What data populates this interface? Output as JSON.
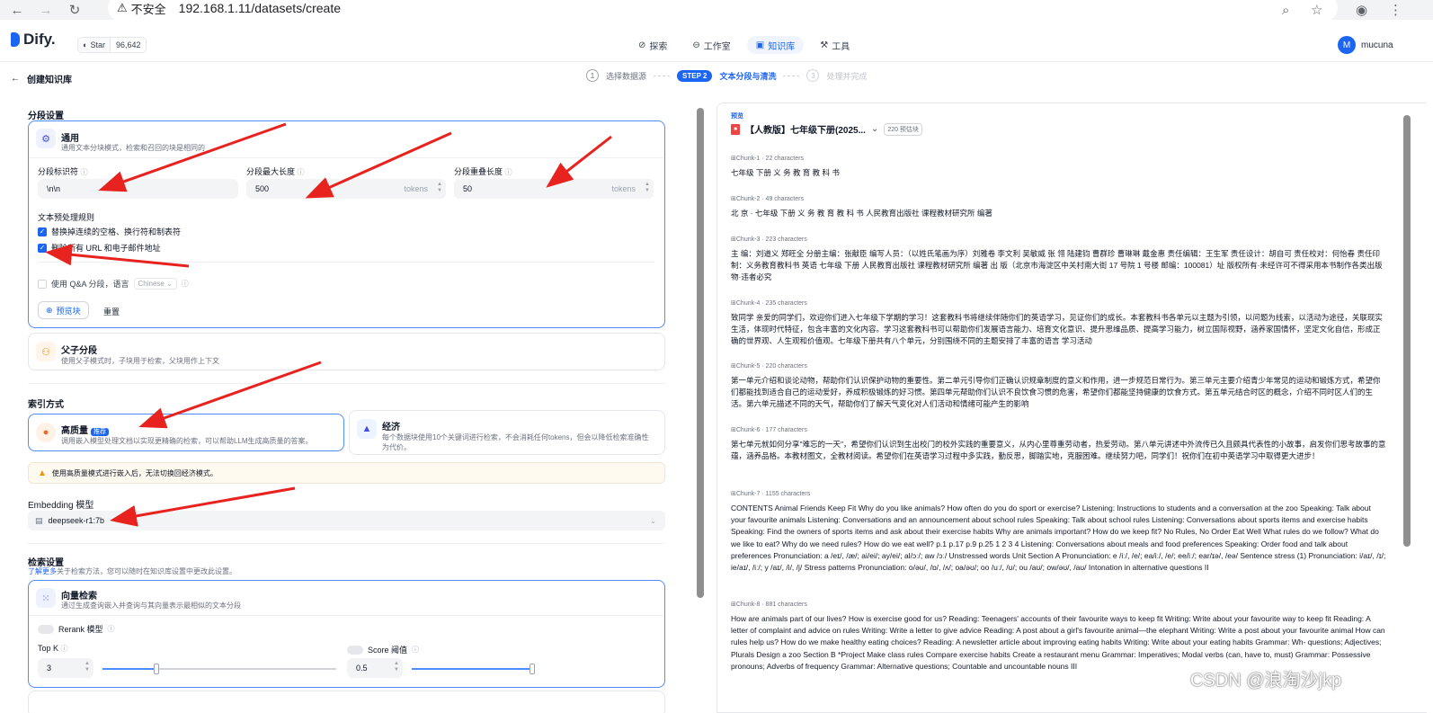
{
  "browser": {
    "security_label": "不安全",
    "url": "192.168.1.11/datasets/create"
  },
  "header": {
    "logo_text": "Dify.",
    "star_label": "Star",
    "star_count": "96,642",
    "nav": [
      {
        "label": "探索",
        "icon": "compass-icon",
        "active": false
      },
      {
        "label": "工作室",
        "icon": "terminal-icon",
        "active": false
      },
      {
        "label": "知识库",
        "icon": "book-icon",
        "active": true
      },
      {
        "label": "工具",
        "icon": "tool-icon",
        "active": false
      }
    ],
    "user_initial": "M",
    "user_name": "mucuna"
  },
  "page": {
    "back_label": "创建知识库",
    "steps": [
      {
        "num": "1",
        "label": "选择数据源"
      },
      {
        "num": "STEP 2",
        "label": "文本分段与清洗"
      },
      {
        "num": "3",
        "label": "处理并完成"
      }
    ]
  },
  "segment": {
    "title": "分段设置",
    "general": {
      "title": "通用",
      "desc": "通用文本分块模式，检索和召回的块是相同的",
      "separator_label": "分段标识符",
      "separator_value": "\\n\\n",
      "max_len_label": "分段最大长度",
      "max_len_value": "500",
      "overlap_label": "分段重叠长度",
      "overlap_value": "50",
      "unit": "tokens",
      "rules_label": "文本预处理规则",
      "rule1": "替换掉连续的空格、换行符和制表符",
      "rule2": "删除所有 URL 和电子邮件地址",
      "qa_label": "使用 Q&A 分段，语言",
      "qa_lang": "Chinese",
      "preview_btn": "预览块",
      "reset_btn": "重置"
    },
    "parent_child": {
      "title": "父子分段",
      "desc": "使用父子模式时，子块用于检索，父块用作上下文"
    }
  },
  "index": {
    "title": "索引方式",
    "high": {
      "title": "高质量",
      "badge": "推荐",
      "desc": "调用嵌入模型处理文档以实现更精确的检索，可以帮助LLM生成高质量的答案。"
    },
    "economy": {
      "title": "经济",
      "desc1": "每个数据块使用10个关键词进行检索，不会消耗任何tokens，但会以降低检索准确性",
      "desc2": "为代价。"
    },
    "warning": "使用高质量模式进行嵌入后，无法切换回经济模式。",
    "embedding_label": "Embedding 模型",
    "embedding_value": "deepseek-r1:7b"
  },
  "retrieval": {
    "title": "检索设置",
    "more_link": "了解更多",
    "desc": "关于检索方法，您可以随时在知识库设置中更改此设置。",
    "vector": {
      "title": "向量检索",
      "desc": "通过生成查询嵌入并查询与其向量表示最相似的文本分段"
    },
    "rerank_label": "Rerank 模型",
    "topk_label": "Top K",
    "topk_value": "3",
    "score_label": "Score 阈值",
    "score_value": "0.5"
  },
  "preview": {
    "heading": "预览",
    "doc_title": "【人教版】七年级下册(2025...",
    "doc_badge": "220 预估块",
    "chunks": [
      {
        "meta": "Chunk-1 · 22 characters",
        "text": "七年级 下册 义 务 教 育 教 科 书"
      },
      {
        "meta": "Chunk-2 · 49 characters",
        "text": "北 京 · 七年级 下册 义 务 教 育 教 科 书 人民教育出版社 课程教材研究所 编著"
      },
      {
        "meta": "Chunk-3 · 223 characters",
        "text": "主 编：刘道义 郑旺全 分册主编：张献臣 编写人员：（以姓氏笔画为序）刘雅卷 李文利 吴敏威 张 翎 陆建钧 曹群珍 曹琳琳 戴金惠 责任编辑：王生军 责任设计：胡自可 责任校对：何怡春 责任印制：义务教育教科书 英语 七年级 下册 人民教育出版社 课程教材研究所 编著 出 版（北京市海淀区中关村南大街 17 号院 1 号楼 邮编：100081）址 版权所有·未经许可不得采用本书制作各类出版物·违者必究"
      },
      {
        "meta": "Chunk-4 · 235 characters",
        "text": "致同学 亲爱的同学们，欢迎你们进入七年级下学期的学习！这套教科书将继续伴随你们的英语学习，见证你们的成长。本套教科书各单元以主题为引领，以问题为线索，以活动为途径，关联现实生活，体现时代特征，包含丰富的文化内容。学习这套教科书可以帮助你们发展语言能力、培育文化意识、提升思维品质、提高学习能力，树立国际视野，涵养家国情怀，坚定文化自信，形成正确的世界观、人生观和价值观。七年级下册共有八个单元，分别围绕不同的主题安排了丰富的语言 学习活动"
      },
      {
        "meta": "Chunk-5 · 220 characters",
        "text": "第一单元介绍和谈论动物，帮助你们认识保护动物的重要性。第二单元引导你们正确认识规章制度的意义和作用，进一步规范日常行为。第三单元主要介绍青少年常见的运动和锻炼方式，希望你们都能找到适合自己的运动爱好，养成积极锻炼的好习惯。第四单元帮助你们认识不良饮食习惯的危害，希望你们都能坚持健康的饮食方式。第五单元结合时区的概念，介绍不同时区人们的生活。第六单元描述不同的天气，帮助你们了解天气变化对人们活动和情绪可能产生的影响"
      },
      {
        "meta": "Chunk-6 · 177 characters",
        "text": "第七单元就如何分享\"难忘的一天\"，希望你们认识到生出校门的校外实践的重要意义，从内心里尊重劳动者，热爱劳动。第八单元讲述中外流传已久且颇具代表性的小故事，启发你们思考故事的意蕴，涵养品格。本教材图文，全教材阅读。希望你们在英语学习过程中多实践，勤反思，脚踏实地，克服困难。继续努力吧，同学们！祝你们在初中英语学习中取得更大进步！"
      },
      {
        "meta": "Chunk-7 · 1155 characters",
        "text": "CONTENTS Animal Friends Keep Fit Why do you like animals? How often do you do sport or exercise? Listening: Instructions to students and a conversation at the zoo Speaking: Talk about your favourite animals Listening: Conversations and an announcement about school rules Speaking: Talk about school rules Listening: Conversations about sports items and exercise habits Speaking: Find the owners of sports items and ask about their exercise habits Why are animals important? How do we keep fit? No Rules, No Order Eat Well What rules do we follow? What do we like to eat? Why do we need rules? How do we eat well? p.1 p.17 p.9 p.25 1 2 3 4 Listening: Conversations about meals and food preferences Speaking: Order food and talk about preferences Pronunciation: a /eɪ/, /æ/; ai/ei/; ay/ei/; al/ɔː/; aw /ɔː/ Unstressed words Unit Section A Pronunciation: e /iː/, /e/; ea/iː/, /e/; ee/iː/; ear/ɪə/, /eə/ Sentence stress (1) Pronunciation: i/aɪ/, /ɪ/; ie/aɪ/, /iː/; y /aɪ/, /i/, /j/ Stress patterns Pronunciation: o/əʊ/, /ɒ/, /ʌ/; oa/əʊ/; oo /uː/, /ʊ/; ou /aʊ/; ow/əʊ/, /aʊ/ Intonation in alternative questions II"
      },
      {
        "meta": "Chunk-8 · 881 characters",
        "text": "How are animals part of our lives? How is exercise good for us? Reading: Teenagers' accounts of their favourite ways to keep fit Writing: Write about your favourite way to keep fit Reading: A letter of complaint and advice on rules Writing: Write a letter to give advice Reading: A post about a girl's favourite animal—the elephant Writing: Write a post about your favourite animal How can rules help us? How do we make healthy eating choices? Reading: A newsletter article about improving eating habits Writing: Write about your eating habits Grammar: Wh- questions; Adjectives; Plurals Design a zoo Section B *Project Make class rules Compare exercise habits Create a restaurant menu Grammar: Imperatives; Modal verbs (can, have to, must) Grammar: Possessive pronouns; Adverbs of frequency Grammar: Alternative questions; Countable and uncountable nouns III"
      }
    ]
  },
  "watermark": "CSDN @浪淘沙jkp",
  "colors": {
    "accent": "#1c64f2",
    "arrow": "#e8231f",
    "warning": "#f79009"
  }
}
